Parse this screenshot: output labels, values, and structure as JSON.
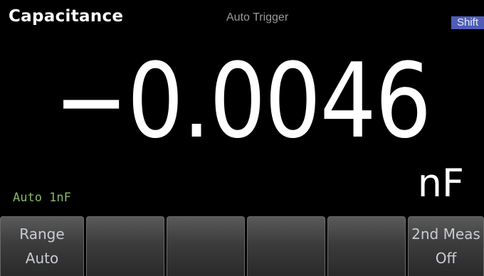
{
  "header": {
    "function": "Capacitance",
    "trigger": "Auto Trigger",
    "shift_indicator": "Shift"
  },
  "measurement": {
    "reading": "−0.0046",
    "unit": "nF",
    "range_status": "Auto 1nF"
  },
  "softkeys": [
    {
      "label": "Range",
      "value": "Auto"
    },
    {
      "label": "",
      "value": ""
    },
    {
      "label": "",
      "value": ""
    },
    {
      "label": "",
      "value": ""
    },
    {
      "label": "",
      "value": ""
    },
    {
      "label": "2nd Meas",
      "value": "Off"
    }
  ],
  "colors": {
    "background": "#000000",
    "range_status": "#8ab86a",
    "shift_indicator": "#4f5db8",
    "trigger_status": "#9a9a9a"
  }
}
